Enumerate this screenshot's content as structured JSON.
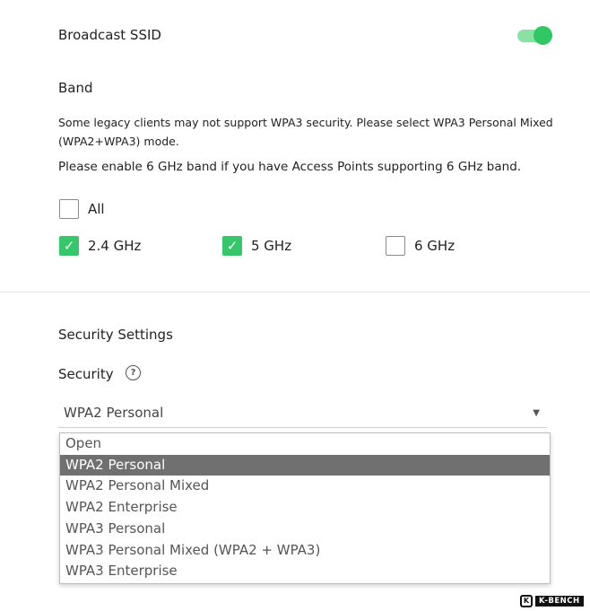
{
  "broadcast": {
    "label": "Broadcast SSID",
    "enabled": true,
    "toggle_color": "#2fc864"
  },
  "band": {
    "title": "Band",
    "note_wpa3": "Some legacy clients may not support WPA3 security. Please select WPA3 Personal Mixed (WPA2+WPA3) mode.",
    "note_6ghz": "Please enable 6 GHz band if you have Access Points supporting 6 GHz band.",
    "options": [
      {
        "label": "All",
        "checked": false
      },
      {
        "label": "2.4 GHz",
        "checked": true
      },
      {
        "label": "5 GHz",
        "checked": true
      },
      {
        "label": "6 GHz",
        "checked": false
      }
    ],
    "check_color": "#35c76a"
  },
  "security": {
    "section_title": "Security Settings",
    "label": "Security",
    "help_icon": "?",
    "selected_value": "WPA2 Personal",
    "dropdown_options": [
      "Open",
      "WPA2 Personal",
      "WPA2 Personal Mixed",
      "WPA2 Enterprise",
      "WPA3 Personal",
      "WPA3 Personal Mixed (WPA2 + WPA3)",
      "WPA3 Enterprise"
    ],
    "highlighted_index": 1
  },
  "watermark": {
    "mark": "K",
    "text": "K-BENCH"
  }
}
